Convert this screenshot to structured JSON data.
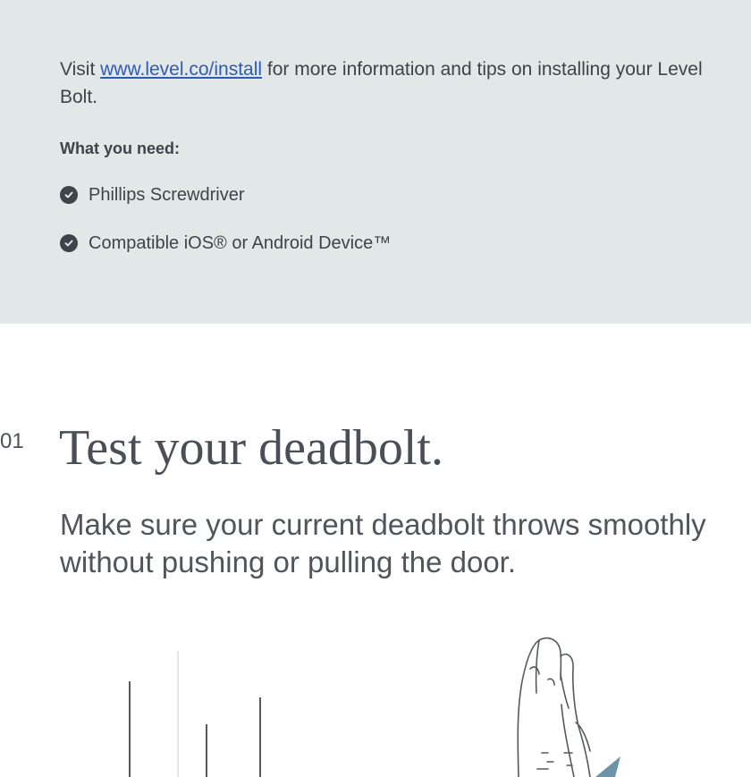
{
  "intro": {
    "prefix": "Visit ",
    "link_text": "www.level.co/install",
    "suffix": " for more information and tips on installing your Level Bolt."
  },
  "what_you_need": {
    "heading": "What you need:",
    "items": [
      {
        "label": "Phillips Screwdriver",
        "icon": "check-circle-icon"
      },
      {
        "label": "Compatible iOS® or Android Device™",
        "icon": "check-circle-icon"
      }
    ]
  },
  "step": {
    "number": "01",
    "title": "Test your deadbolt.",
    "description": "Make sure your current deadbolt throws smoothly without pushing or pulling the door."
  },
  "colors": {
    "panel_bg": "#e2e7e7",
    "text": "#3f444b",
    "link": "#2f5bb8",
    "accent_arrow": "#6d93a9"
  }
}
